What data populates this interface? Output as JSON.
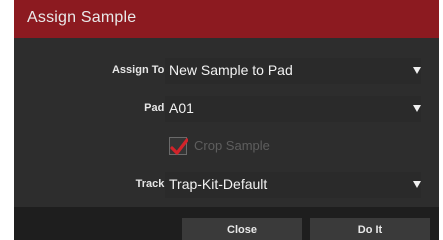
{
  "dialog": {
    "title": "Assign Sample"
  },
  "fields": {
    "assign_to": {
      "label": "Assign To:",
      "value": "New Sample to Pad",
      "icon": "caret-down-icon"
    },
    "pad": {
      "label": "Pad:",
      "value": "A01",
      "icon": "caret-down-icon"
    },
    "crop_sample": {
      "label": "Crop Sample",
      "checked": true,
      "enabled": false,
      "check_color": "#d2232a"
    },
    "track": {
      "label": "Track:",
      "value": "Trap-Kit-Default",
      "icon": "caret-down-icon"
    }
  },
  "buttons": {
    "close_label": "Close",
    "do_it_label": "Do It"
  },
  "colors": {
    "title_bar": "#8c1a20",
    "dialog_bg": "#2d2d2d",
    "footer_bg": "#1e1e1e",
    "button_bg": "#3a3a3a"
  }
}
